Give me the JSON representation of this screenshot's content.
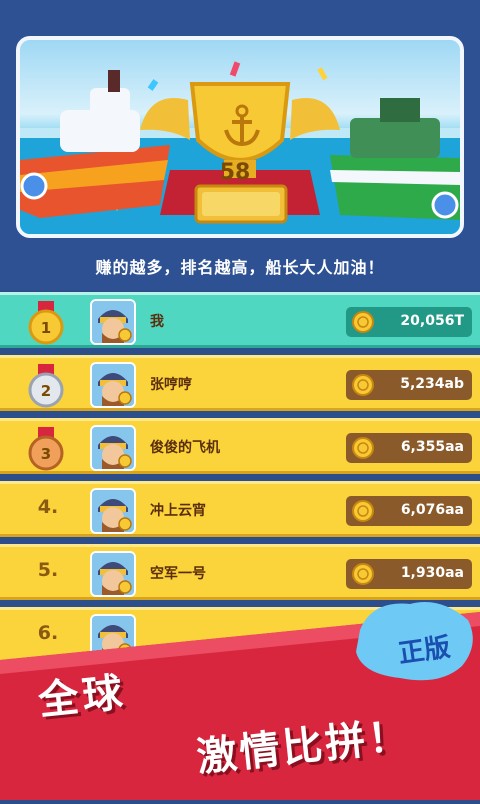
{
  "banner": {
    "trophy_number": "58"
  },
  "subtitle": "赚的越多，排名越高，船长大人加油！",
  "leaderboard": [
    {
      "rank": "1",
      "rank_label": "",
      "medal": "gold",
      "name": "我",
      "score": "20,056T",
      "is_me": true
    },
    {
      "rank": "2",
      "rank_label": "",
      "medal": "silver",
      "name": "张哼哼",
      "score": "5,234ab",
      "is_me": false
    },
    {
      "rank": "3",
      "rank_label": "",
      "medal": "bronze",
      "name": "俊俊的飞机",
      "score": "6,355aa",
      "is_me": false
    },
    {
      "rank": "4",
      "rank_label": "4.",
      "medal": "none",
      "name": "冲上云宵",
      "score": "6,076aa",
      "is_me": false
    },
    {
      "rank": "5",
      "rank_label": "5.",
      "medal": "none",
      "name": "空军一号",
      "score": "1,930aa",
      "is_me": false
    },
    {
      "rank": "6",
      "rank_label": "6.",
      "medal": "none",
      "name": "",
      "score": "",
      "is_me": false
    }
  ],
  "promo": {
    "line1": "全球",
    "line2": "激情比拼！",
    "badge": "正版"
  },
  "colors": {
    "background": "#2c4f8c",
    "row": "#fbd33a",
    "row_me": "#4fd7c2",
    "promo_red": "#d8263f"
  },
  "icons": [
    "anchor-icon",
    "coin-icon",
    "medal-icon",
    "avatar-pilot"
  ]
}
